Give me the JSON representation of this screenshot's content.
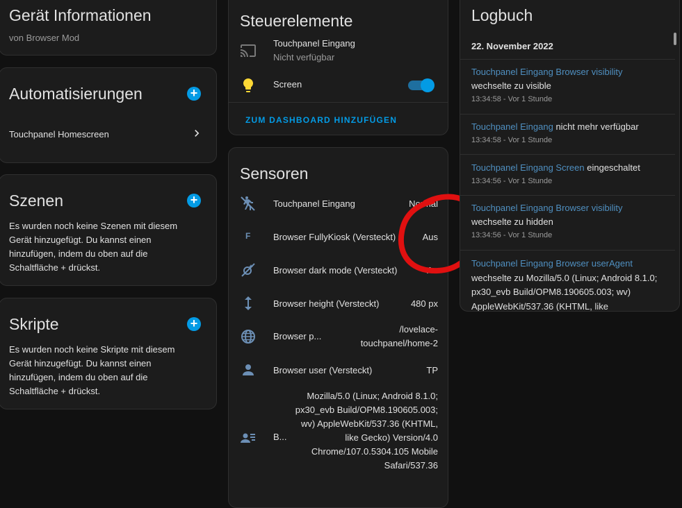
{
  "device_info": {
    "title": "Gerät Informationen",
    "subtitle": "von Browser Mod"
  },
  "automations": {
    "title": "Automatisierungen",
    "items": [
      {
        "label": "Touchpanel Homescreen"
      }
    ]
  },
  "scenes": {
    "title": "Szenen",
    "empty_text": "Es wurden noch keine Szenen mit diesem Gerät hinzugefügt. Du kannst einen hinzufügen, indem du oben auf die Schaltfläche + drückst."
  },
  "scripts": {
    "title": "Skripte",
    "empty_text": "Es wurden noch keine Skripte mit diesem Gerät hinzugefügt. Du kannst einen hinzufügen, indem du oben auf die Schaltfläche + drückst."
  },
  "controls": {
    "title": "Steuerelemente",
    "items": [
      {
        "label": "Touchpanel Eingang",
        "state": "Nicht verfügbar",
        "icon": "cast-icon"
      },
      {
        "label": "Screen",
        "icon": "lightbulb-icon",
        "toggle_on": true
      }
    ],
    "add_button": "ZUM DASHBOARD HINZUFÜGEN"
  },
  "sensors": {
    "title": "Sensoren",
    "items": [
      {
        "label": "Touchpanel Eingang",
        "value": "Normal",
        "icon": "motion-sensor-off-icon"
      },
      {
        "label": "Browser FullyKiosk (Versteckt)",
        "value": "Aus",
        "icon": "fully-kiosk-icon"
      },
      {
        "label": "Browser dark mode (Versteckt)",
        "value": "An",
        "icon": "theme-light-dark-icon"
      },
      {
        "label": "Browser height (Versteckt)",
        "value": "480 px",
        "icon": "arrow-vertical-icon"
      },
      {
        "label": "Browser p...",
        "value": "/lovelace-touchpanel/home-2",
        "icon": "web-icon"
      },
      {
        "label": "Browser user (Versteckt)",
        "value": "TP",
        "icon": "account-icon"
      },
      {
        "label": "B...",
        "value": "Mozilla/5.0 (Linux; Android 8.1.0; px30_evb Build/OPM8.190605.003; wv) AppleWebKit/537.36 (KHTML, like Gecko) Version/4.0 Chrome/107.0.5304.105 Mobile Safari/537.36",
        "icon": "account-details-icon"
      }
    ]
  },
  "logbook": {
    "title": "Logbuch",
    "date": "22. November 2022",
    "entries": [
      {
        "entity": "Touchpanel Eingang Browser visibility",
        "message": "wechselte zu visible",
        "time": "13:34:58 - Vor 1 Stunde"
      },
      {
        "entity": "Touchpanel Eingang",
        "message": "nicht mehr verfügbar",
        "time": "13:34:58 - Vor 1 Stunde"
      },
      {
        "entity": "Touchpanel Eingang Screen",
        "message": "eingeschaltet",
        "time": "13:34:56 - Vor 1 Stunde"
      },
      {
        "entity": "Touchpanel Eingang Browser visibility",
        "message": "wechselte zu hidden",
        "time": "13:34:56 - Vor 1 Stunde"
      },
      {
        "entity": "Touchpanel Eingang Browser userAgent",
        "message": "wechselte zu Mozilla/5.0 (Linux; Android 8.1.0; px30_evb Build/OPM8.190605.003; wv) AppleWebKit/537.36 (KHTML, like"
      }
    ]
  },
  "colors": {
    "accent": "#039be5",
    "annotation": "#e01010",
    "link": "#4f8fc0",
    "icon": "#6c8fb5",
    "bulb": "#fdd835"
  }
}
